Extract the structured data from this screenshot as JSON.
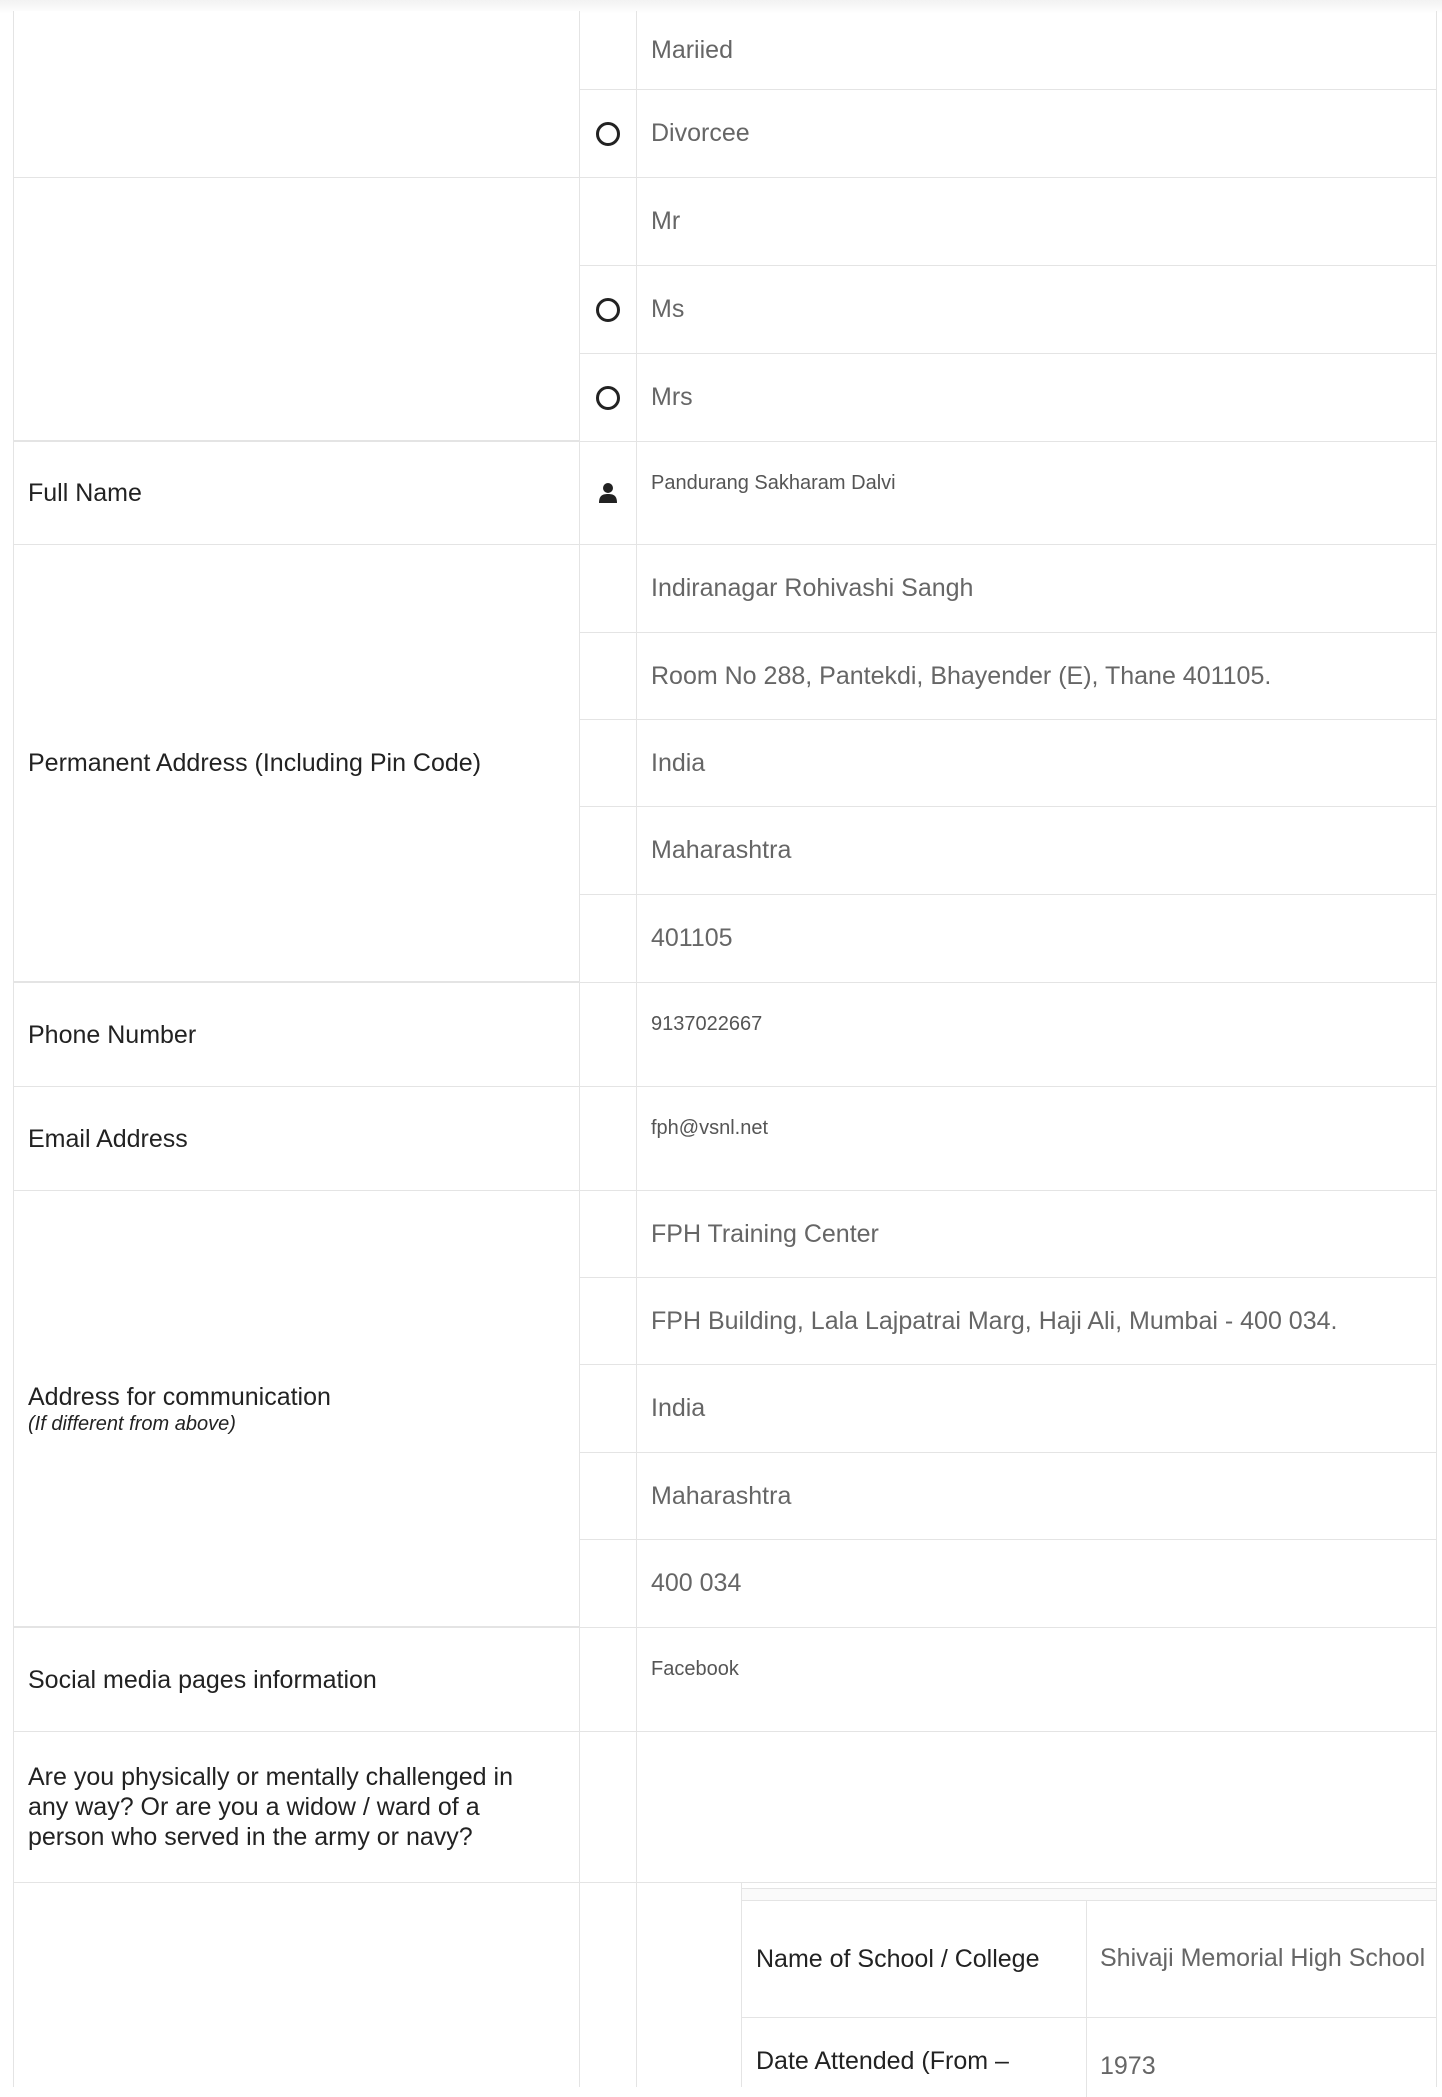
{
  "marital": {
    "options": [
      "Mariied",
      "Divorcee"
    ]
  },
  "title_prefix": {
    "options": [
      "Mr",
      "Ms",
      "Mrs"
    ]
  },
  "full_name": {
    "label": "Full Name",
    "value": "Pandurang Sakharam Dalvi",
    "icon": "user-icon"
  },
  "permanent_address": {
    "label": "Permanent Address (Including Pin Code)",
    "line1": "Indiranagar Rohivashi Sangh",
    "line2": "Room No 288, Pantekdi, Bhayender (E), Thane 401105.",
    "country": "India",
    "state": "Maharashtra",
    "pin": "401105"
  },
  "phone": {
    "label": "Phone Number",
    "value": "9137022667"
  },
  "email": {
    "label": "Email Address",
    "value": "fph@vsnl.net"
  },
  "communication_address": {
    "label": "Address for communication",
    "sublabel": "(If different from above)",
    "line1": "FPH Training Center",
    "line2": "FPH Building, Lala Lajpatrai Marg, Haji Ali, Mumbai - 400 034.",
    "country": "India",
    "state": "Maharashtra",
    "pin": "400 034"
  },
  "social": {
    "label": "Social media pages information",
    "value": "Facebook"
  },
  "challenged": {
    "label": "Are you physically or mentally challenged in any way? Or are you a widow / ward of a person who served in the army or navy?"
  },
  "education": {
    "school_label": "Name of School / College",
    "school_value": "Shivaji Memorial High School",
    "dates_label": "Date Attended (From –",
    "dates_value": "1973"
  }
}
